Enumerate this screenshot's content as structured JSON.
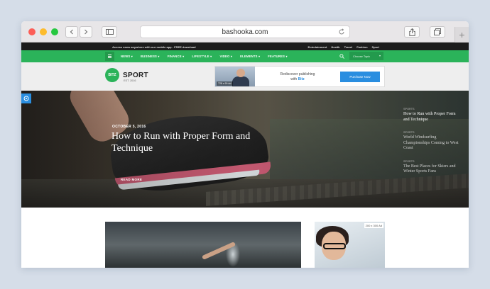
{
  "browser": {
    "url": "bashooka.com"
  },
  "topbar": {
    "message": "Access news anywhere with our mobile app - FREE download",
    "links": [
      "Entertainment",
      "Health",
      "Travel",
      "Fashion",
      "Sport"
    ]
  },
  "nav": {
    "items": [
      "NEWS",
      "BUSINESS",
      "FINANCE",
      "LIFESTYLE",
      "VIDEO",
      "ELEMENTS",
      "FEATURES"
    ],
    "choose_placeholder": "Choose Topic"
  },
  "brand": {
    "badge": "BITZ",
    "name": "SPORT",
    "sub": "EST. 2016",
    "accent": "#2bb35a"
  },
  "banner_ad": {
    "size_label": "728 x 90 Ad",
    "text_line1": "Rediscover publishing",
    "text_line2_prefix": "with",
    "text_line2_brand": "Bitz",
    "button": "Purchase Now"
  },
  "hero": {
    "date": "OCTOBER 5, 2016",
    "title": "How to Run with Proper Form and Technique",
    "read_more": "READ MORE"
  },
  "side_posts": [
    {
      "category": "SPORTS",
      "title": "How to Run with Proper Form and Technique"
    },
    {
      "category": "SPORTS",
      "title": "World Windsurfing Championships Coming to West Coast"
    },
    {
      "category": "SPORTS",
      "title": "The Best Places for Skiers and Winter Sports Fans"
    }
  ],
  "content_ad": {
    "size_label": "200 x 300 Ad"
  }
}
